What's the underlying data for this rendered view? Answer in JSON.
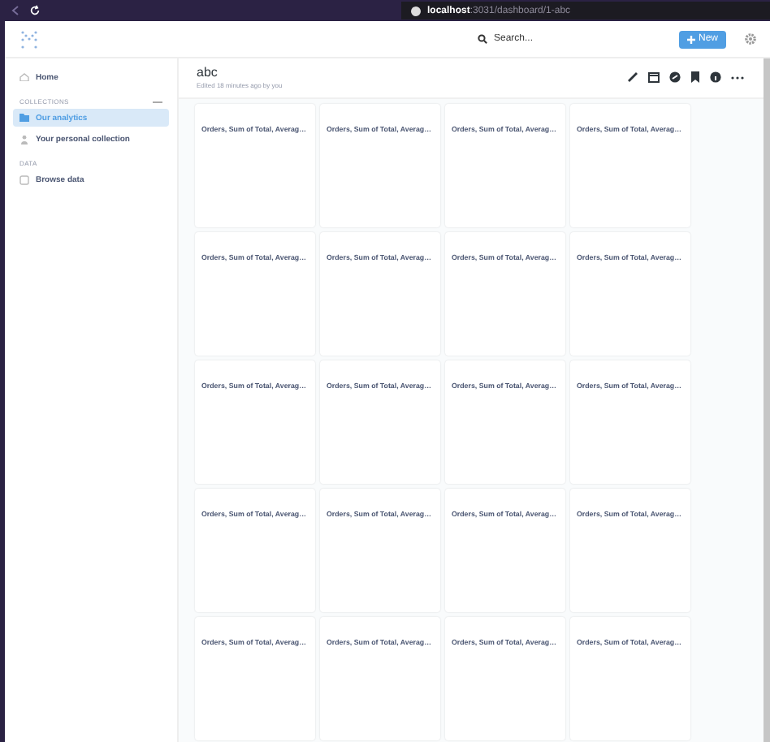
{
  "browser": {
    "url_host": "localhost",
    "url_path": ":3031/dashboard/1-abc"
  },
  "header": {
    "search": {
      "placeholder": "Search..."
    },
    "new_button": "New"
  },
  "sidebar": {
    "items": [
      {
        "kind": "link",
        "label": "Home",
        "selected": false
      },
      {
        "kind": "section",
        "label": "COLLECTIONS"
      },
      {
        "kind": "link",
        "label": "Our analytics",
        "selected": true
      },
      {
        "kind": "link",
        "label": "Your personal collection",
        "selected": false
      },
      {
        "kind": "section",
        "label": "DATA"
      },
      {
        "kind": "link",
        "label": "Browse data",
        "selected": false
      }
    ]
  },
  "dashboard": {
    "title": "abc",
    "subtitle": "Edited 18 minutes ago by you",
    "cards": [
      {
        "title": "Orders, Sum of Total, Averag…"
      },
      {
        "title": "Orders, Sum of Total, Averag…"
      },
      {
        "title": "Orders, Sum of Total, Averag…"
      },
      {
        "title": "Orders, Sum of Total, Averag…"
      },
      {
        "title": "Orders, Sum of Total, Averag…"
      },
      {
        "title": "Orders, Sum of Total, Averag…"
      },
      {
        "title": "Orders, Sum of Total, Averag…"
      },
      {
        "title": "Orders, Sum of Total, Averag…"
      },
      {
        "title": "Orders, Sum of Total, Averag…"
      },
      {
        "title": "Orders, Sum of Total, Averag…"
      },
      {
        "title": "Orders, Sum of Total, Averag…"
      },
      {
        "title": "Orders, Sum of Total, Averag…"
      },
      {
        "title": "Orders, Sum of Total, Averag…"
      },
      {
        "title": "Orders, Sum of Total, Averag…"
      },
      {
        "title": "Orders, Sum of Total, Averag…"
      },
      {
        "title": "Orders, Sum of Total, Averag…"
      },
      {
        "title": "Orders, Sum of Total, Averag…"
      },
      {
        "title": "Orders, Sum of Total, Averag…"
      },
      {
        "title": "Orders, Sum of Total, Averag…"
      },
      {
        "title": "Orders, Sum of Total, Averag…"
      }
    ]
  }
}
